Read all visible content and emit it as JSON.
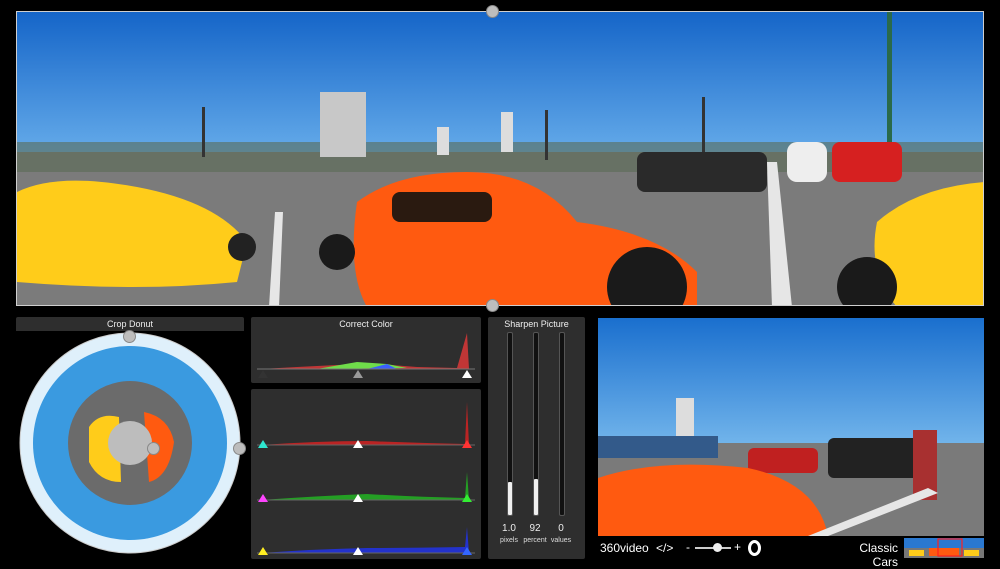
{
  "panels": {
    "crop_donut_title": "Crop Donut",
    "correct_color_title": "Correct Color",
    "sharpen_title": "Sharpen Picture"
  },
  "sharpen": {
    "sliders": [
      {
        "value": "1.0",
        "caption": "pixels",
        "level": 0.18
      },
      {
        "value": "92",
        "caption": "percent",
        "level": 0.2
      },
      {
        "value": "0",
        "caption": "values",
        "level": 0.0
      }
    ]
  },
  "toolbar": {
    "brand": "360video",
    "embed_label": "</>",
    "zoom_minus": "-",
    "zoom_plus": "+",
    "zoom_level": 0.6,
    "title": "Classic Cars"
  },
  "colors": {
    "sky": "#1f7fd4",
    "asphalt": "#777777",
    "car_orange": "#ff5a10",
    "car_yellow": "#ffcc1a",
    "panel": "#2e2e2e"
  }
}
